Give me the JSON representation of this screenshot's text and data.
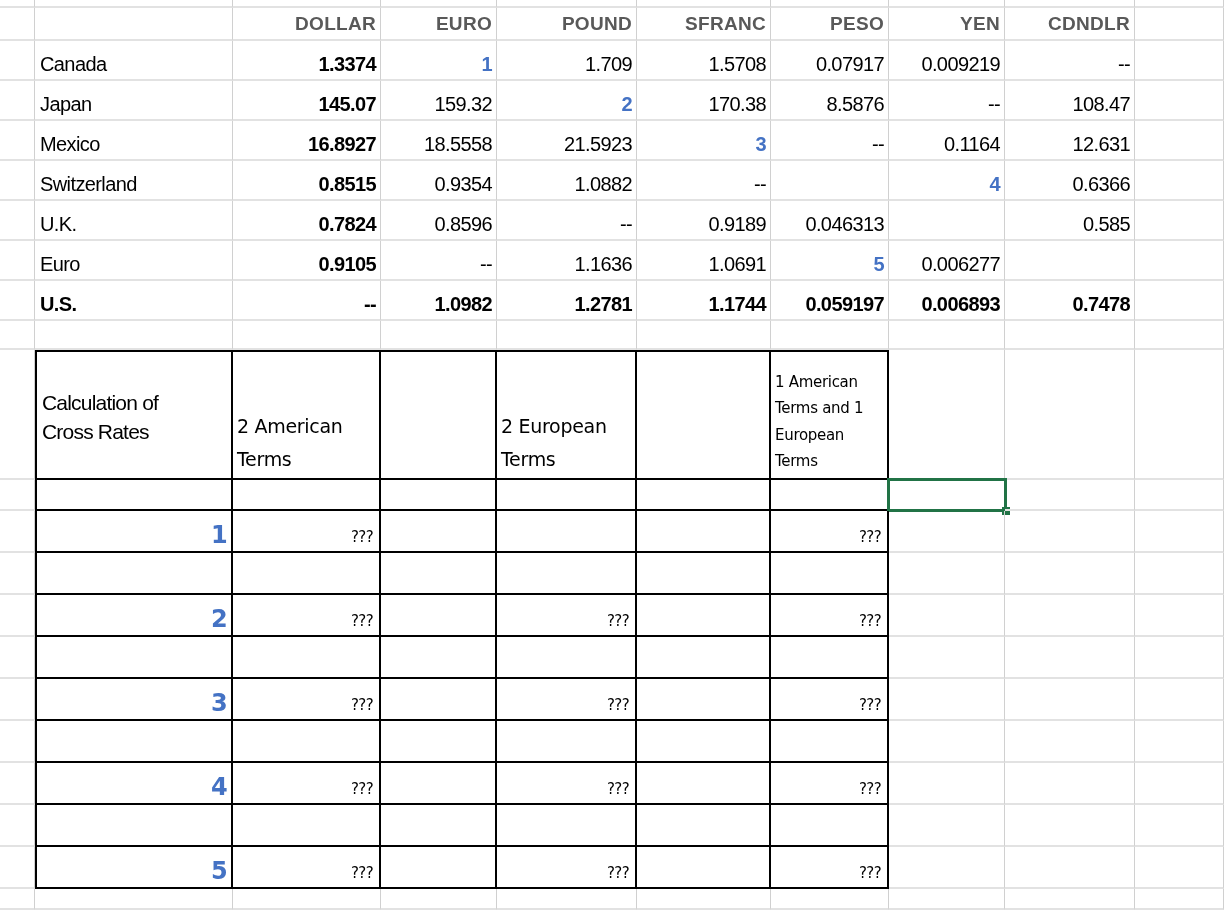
{
  "rates": {
    "columns": [
      "DOLLAR",
      "EURO",
      "POUND",
      "SFRANC",
      "PESO",
      "YEN",
      "CDNDLR"
    ],
    "rows": [
      {
        "label": "Canada",
        "bold": false,
        "cells": [
          {
            "text": "1.3374",
            "kind": "bold"
          },
          {
            "text": "1",
            "kind": "highlight"
          },
          {
            "text": "1.709",
            "kind": "plain"
          },
          {
            "text": "1.5708",
            "kind": "plain"
          },
          {
            "text": "0.07917",
            "kind": "plain"
          },
          {
            "text": "0.009219",
            "kind": "plain"
          },
          {
            "text": "--",
            "kind": "plain"
          }
        ]
      },
      {
        "label": "Japan",
        "bold": false,
        "cells": [
          {
            "text": "145.07",
            "kind": "bold"
          },
          {
            "text": "159.32",
            "kind": "plain"
          },
          {
            "text": "2",
            "kind": "highlight"
          },
          {
            "text": "170.38",
            "kind": "plain"
          },
          {
            "text": "8.5876",
            "kind": "plain"
          },
          {
            "text": "--",
            "kind": "plain"
          },
          {
            "text": "108.47",
            "kind": "plain"
          }
        ]
      },
      {
        "label": "Mexico",
        "bold": false,
        "cells": [
          {
            "text": "16.8927",
            "kind": "bold"
          },
          {
            "text": "18.5558",
            "kind": "plain"
          },
          {
            "text": "21.5923",
            "kind": "plain"
          },
          {
            "text": "3",
            "kind": "highlight"
          },
          {
            "text": "--",
            "kind": "plain"
          },
          {
            "text": "0.1164",
            "kind": "plain"
          },
          {
            "text": "12.631",
            "kind": "plain"
          }
        ]
      },
      {
        "label": "Switzerland",
        "bold": false,
        "cells": [
          {
            "text": "0.8515",
            "kind": "bold"
          },
          {
            "text": "0.9354",
            "kind": "plain"
          },
          {
            "text": "1.0882",
            "kind": "plain"
          },
          {
            "text": "--",
            "kind": "plain"
          },
          null,
          {
            "text": "4",
            "kind": "highlight"
          },
          {
            "text": "0.6366",
            "kind": "plain"
          }
        ]
      },
      {
        "label": "U.K.",
        "bold": false,
        "cells": [
          {
            "text": "0.7824",
            "kind": "bold"
          },
          {
            "text": "0.8596",
            "kind": "plain"
          },
          {
            "text": "--",
            "kind": "plain"
          },
          {
            "text": "0.9189",
            "kind": "plain"
          },
          {
            "text": "0.046313",
            "kind": "plain"
          },
          null,
          {
            "text": "0.585",
            "kind": "plain"
          }
        ]
      },
      {
        "label": "Euro",
        "bold": false,
        "cells": [
          {
            "text": "0.9105",
            "kind": "bold"
          },
          {
            "text": "--",
            "kind": "plain"
          },
          {
            "text": "1.1636",
            "kind": "plain"
          },
          {
            "text": "1.0691",
            "kind": "plain"
          },
          {
            "text": "5",
            "kind": "highlight"
          },
          {
            "text": "0.006277",
            "kind": "plain"
          },
          null
        ]
      },
      {
        "label": "U.S.",
        "bold": true,
        "cells": [
          {
            "text": "--",
            "kind": "bold"
          },
          {
            "text": "1.0982",
            "kind": "bold"
          },
          {
            "text": "1.2781",
            "kind": "bold"
          },
          {
            "text": "1.1744",
            "kind": "bold"
          },
          {
            "text": "0.059197",
            "kind": "bold"
          },
          {
            "text": "0.006893",
            "kind": "bold"
          },
          {
            "text": "0.7478",
            "kind": "bold"
          }
        ]
      }
    ]
  },
  "calc": {
    "title": "Calculation of Cross Rates",
    "columns": [
      "2 American Terms",
      null,
      "2 European Terms",
      null,
      "1 American Terms and 1 European Terms"
    ],
    "rows": [
      {
        "number": "1",
        "cells": [
          "???",
          null,
          null,
          null,
          "???"
        ]
      },
      {
        "number": "2",
        "cells": [
          "???",
          null,
          "???",
          null,
          "???"
        ]
      },
      {
        "number": "3",
        "cells": [
          "???",
          null,
          "???",
          null,
          "???"
        ]
      },
      {
        "number": "4",
        "cells": [
          "???",
          null,
          "???",
          null,
          "???"
        ]
      },
      {
        "number": "5",
        "cells": [
          "???",
          null,
          "???",
          null,
          "???"
        ]
      }
    ]
  }
}
